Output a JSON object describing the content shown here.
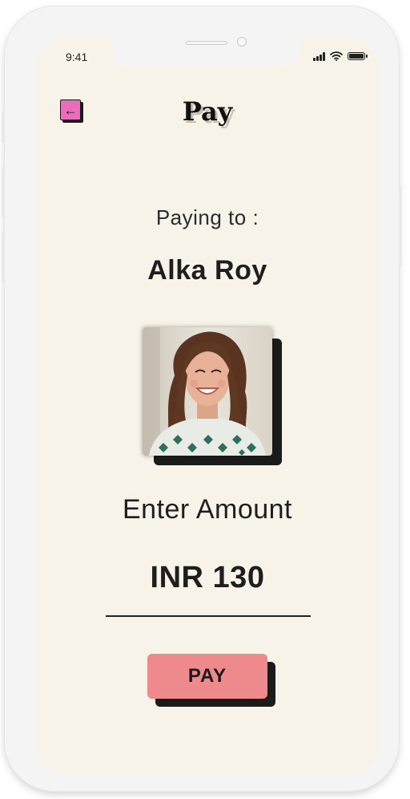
{
  "status_bar": {
    "time": "9:41",
    "signal_icon": "signal-icon",
    "wifi_icon": "wifi-icon",
    "battery_icon": "battery-icon"
  },
  "header": {
    "title": "Pay",
    "back_icon": "arrow-left-icon",
    "back_glyph": "←"
  },
  "payee": {
    "prompt": "Paying to :",
    "name": "Alka Roy"
  },
  "amount": {
    "label": "Enter Amount",
    "value": "INR 130"
  },
  "action": {
    "pay_label": "PAY"
  },
  "colors": {
    "background": "#f7f3e8",
    "back_button": "#e86dbb",
    "pay_button": "#ef8a8c",
    "shadow": "#1b1b1b"
  }
}
